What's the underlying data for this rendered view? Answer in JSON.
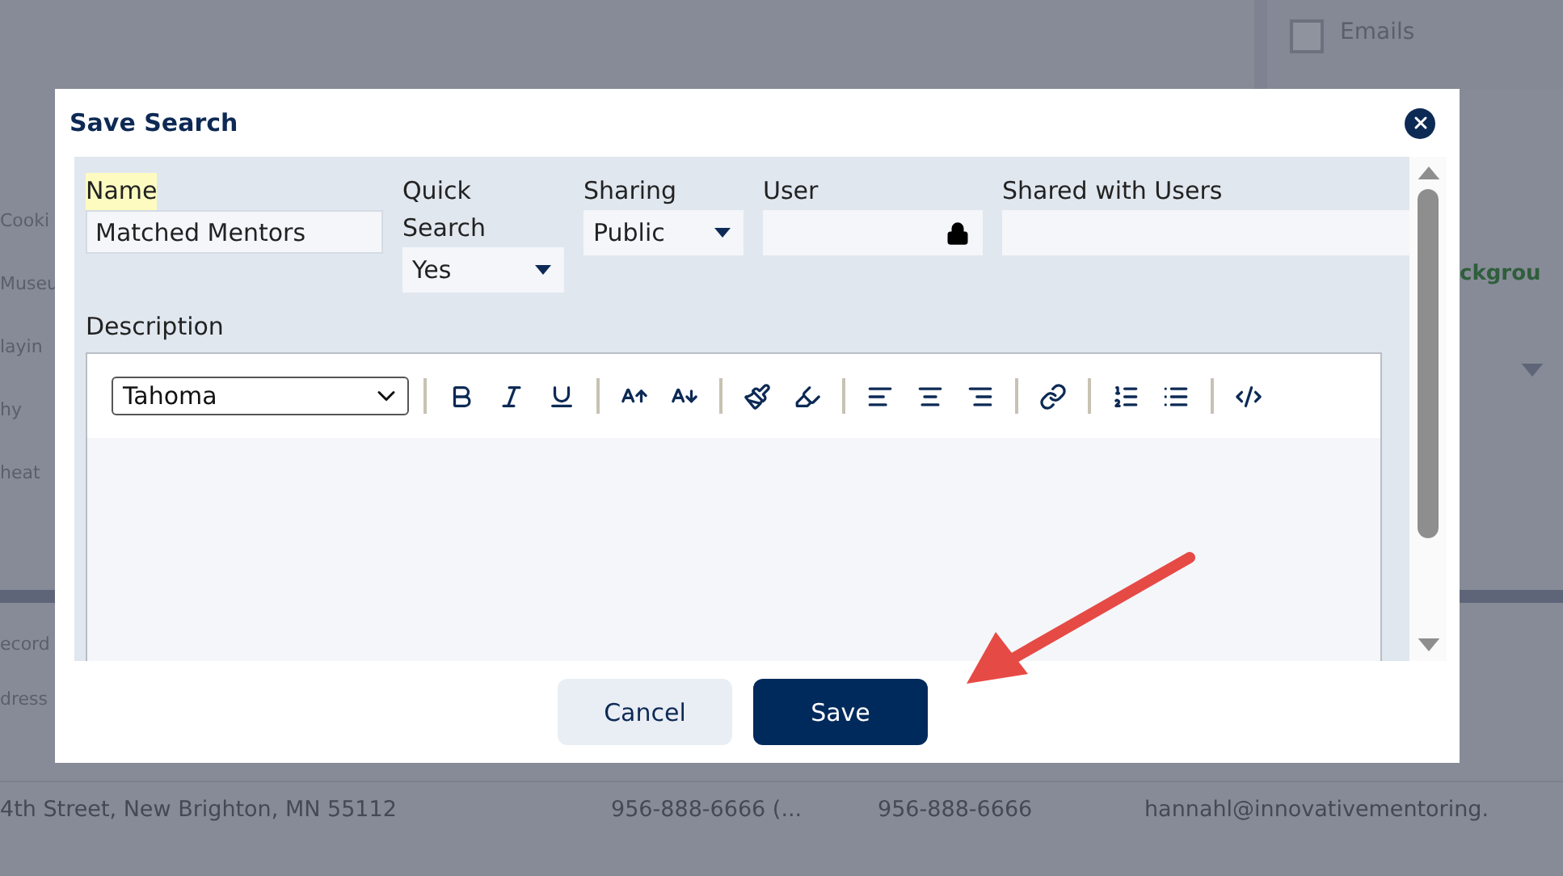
{
  "background": {
    "left_items": [
      "Cooki",
      "Museu",
      "layin",
      "hy",
      "heat"
    ],
    "panel_checkbox": {
      "label": "Emails",
      "checked": false
    },
    "panel_heading": "ckgrou",
    "table_labels": [
      "ecord",
      "dress"
    ],
    "rows": [
      [
        "4th Street, New Brighton, MN 55112",
        "956-888-6666 (...",
        "956-888-6666",
        "hannahl@innovativementoring."
      ]
    ]
  },
  "dialog": {
    "title": "Save Search",
    "fields": [
      {
        "kind": "text",
        "label": "Name",
        "value": "Matched Mentors",
        "highlighted": true
      },
      {
        "kind": "select",
        "label": "Quick Search",
        "value": "Yes",
        "highlighted": false
      },
      {
        "kind": "select",
        "label": "Sharing",
        "value": "Public",
        "highlighted": false
      },
      {
        "kind": "locked",
        "label": "User",
        "highlighted": false
      },
      {
        "kind": "multiselect",
        "label": "Shared with Users",
        "highlighted": false
      }
    ],
    "description": {
      "label": "Description",
      "font": "Tahoma"
    },
    "buttons": [
      {
        "label": "Cancel",
        "kind": "secondary"
      },
      {
        "label": "Save",
        "kind": "primary"
      }
    ]
  }
}
